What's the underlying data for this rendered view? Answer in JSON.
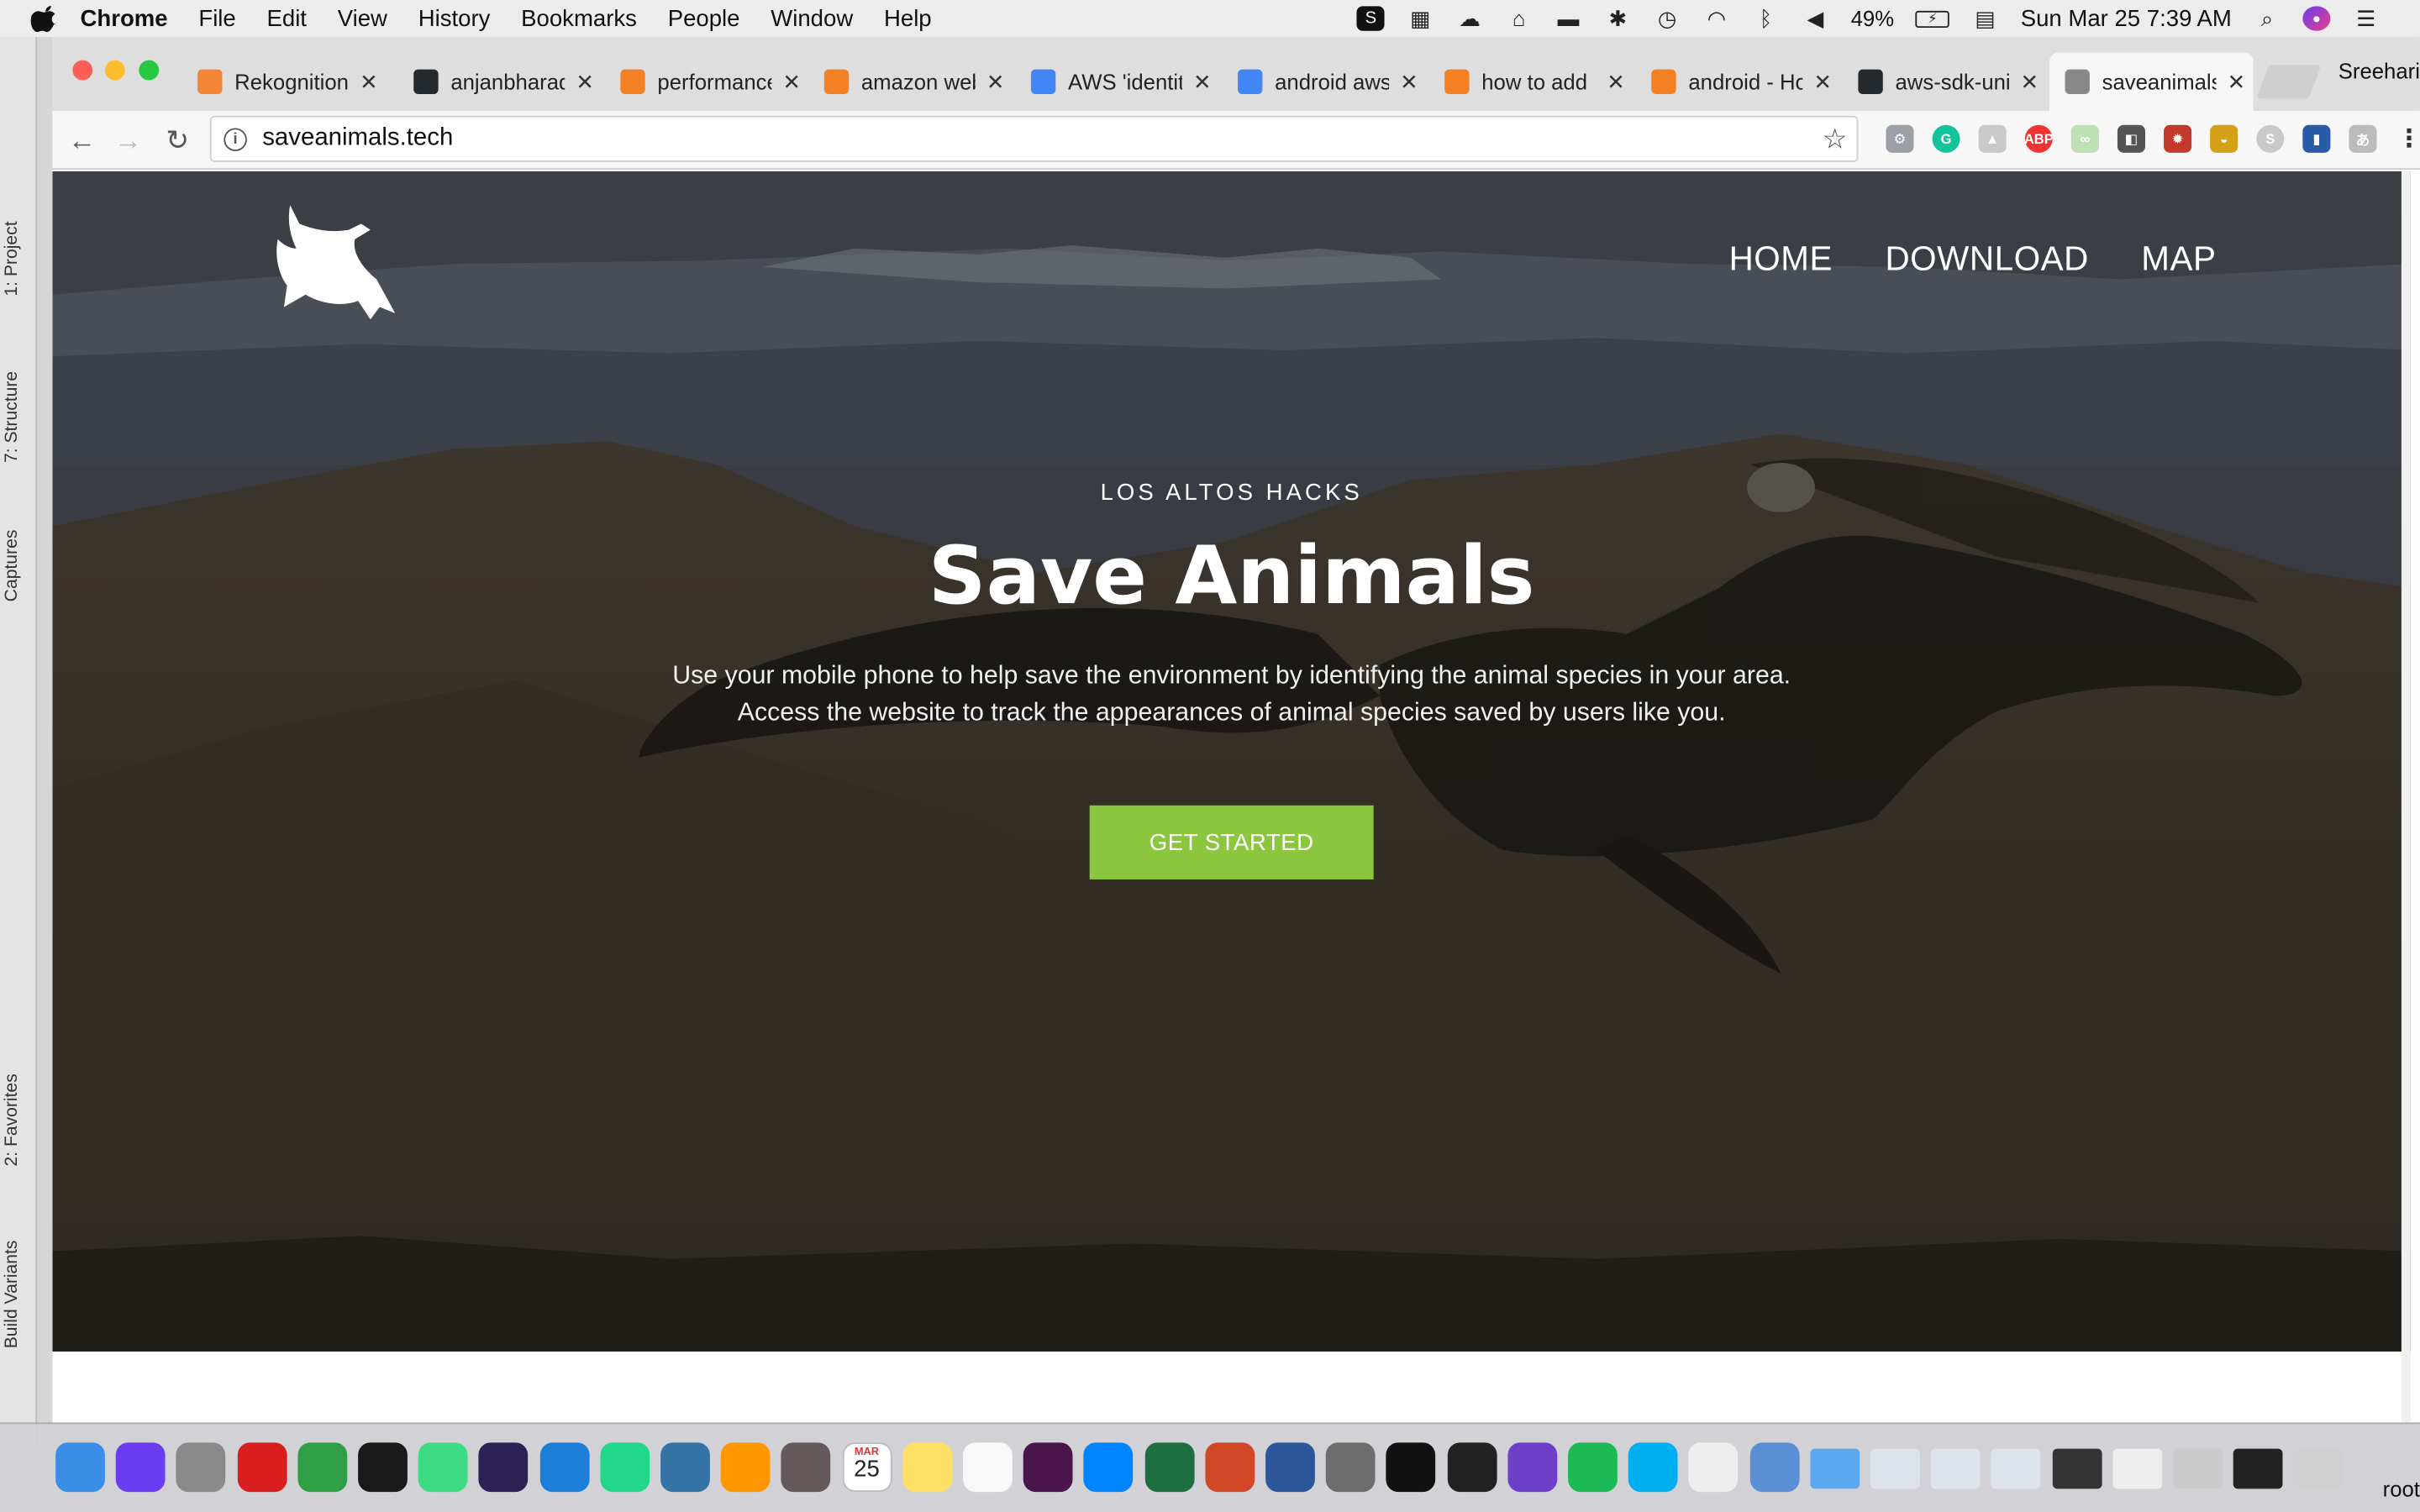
{
  "menubar": {
    "app": "Chrome",
    "items": [
      "File",
      "Edit",
      "View",
      "History",
      "Bookmarks",
      "People",
      "Window",
      "Help"
    ],
    "battery": "49%",
    "clock": "Sun Mar 25  7:39 AM"
  },
  "ide": {
    "tabs": [
      "1: Project",
      "7: Structure",
      "Captures",
      "2: Favorites",
      "Build Variants"
    ]
  },
  "browser": {
    "profile": "Sreehari",
    "tabs": [
      {
        "title": "Rekognition",
        "color": "#f58536"
      },
      {
        "title": "anjanbharad",
        "color": "#24292e"
      },
      {
        "title": "performance",
        "color": "#f48024"
      },
      {
        "title": "amazon web",
        "color": "#f48024"
      },
      {
        "title": "AWS 'identit",
        "color": "#4285f4"
      },
      {
        "title": "android aws",
        "color": "#4285f4"
      },
      {
        "title": "how to add",
        "color": "#f48024"
      },
      {
        "title": "android - Ho",
        "color": "#f48024"
      },
      {
        "title": "aws-sdk-unit",
        "color": "#24292e"
      },
      {
        "title": "saveanimals",
        "color": "#888888"
      }
    ],
    "url": "saveanimals.tech"
  },
  "site": {
    "nav": [
      "HOME",
      "DOWNLOAD",
      "MAP"
    ],
    "kicker": "LOS ALTOS HACKS",
    "title": "Save Animals",
    "desc1": "Use your mobile phone to help save the environment by identifying the animal species in your area.",
    "desc2": "Access the website to track the appearances of animal species saved by users like you.",
    "cta": "GET STARTED",
    "accent": "#8cc63f"
  },
  "dock": {
    "calendar_day": "25",
    "calendar_month": "MAR",
    "user": "root"
  }
}
